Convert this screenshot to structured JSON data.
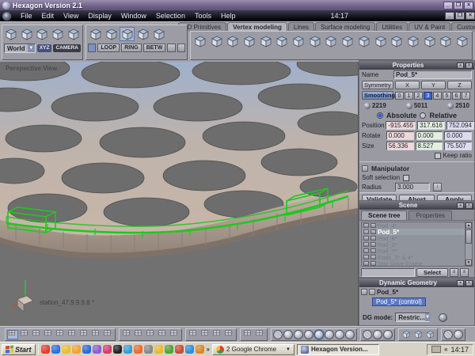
{
  "window": {
    "title": "Hexagon Version 2.1",
    "time": "14:17",
    "buttons": {
      "minimize": "_",
      "restore": "❐",
      "close": "×"
    }
  },
  "menu": {
    "items": [
      "File",
      "Edit",
      "View",
      "Display",
      "Window",
      "Selection",
      "Tools",
      "Help"
    ]
  },
  "tabs": {
    "items": [
      {
        "label": "3D Primitives",
        "active": false
      },
      {
        "label": "Vertex modeling",
        "active": true
      },
      {
        "label": "Lines",
        "active": false
      },
      {
        "label": "Surface modeling",
        "active": false
      },
      {
        "label": "Utilities",
        "active": false
      },
      {
        "label": "UV & Paint",
        "active": false
      },
      {
        "label": "Custom",
        "active": false
      }
    ]
  },
  "toolbar": {
    "world_dropdown": "World",
    "xyz_label": "XYZ",
    "camera_label": "CAMERA",
    "loop_label": "LOOP",
    "ring_label": "RING",
    "betw_label": "BETW"
  },
  "viewport": {
    "view_label": "Perspective View",
    "status_text": "station_47.9.9.9.8 *"
  },
  "properties_panel": {
    "title": "Properties",
    "name_label": "Name",
    "name_value": "Pod_5*",
    "symmetry_label": "Symmetry",
    "axis_buttons": [
      "X",
      "Y",
      "Z"
    ],
    "smoothing_label": "Smoothing",
    "smoothing_levels": [
      "0",
      "1",
      "2",
      "3",
      "4",
      "5",
      "6",
      "7"
    ],
    "smoothing_selected": "3",
    "counts": [
      "2219",
      "5011",
      "2510"
    ],
    "mode_absolute": "Absolute",
    "mode_relative": "Relative",
    "rows": [
      {
        "label": "Position",
        "x": "-915.455",
        "y": "317.616",
        "z": "752.094"
      },
      {
        "label": "Rotate",
        "x": "0.000",
        "y": "0.000",
        "z": "0.000"
      },
      {
        "label": "Size",
        "x": "56.336",
        "y": "8.527",
        "z": "75.507"
      }
    ],
    "keep_ratio_label": "Keep ratio",
    "manipulator_label": "Manipulator",
    "soft_selection_label": "Soft selection",
    "radius_label": "Radius",
    "radius_value": "3.000",
    "validate_label": "Validate",
    "abort_label": "Abort",
    "apply_label": "Apply"
  },
  "scene_panel": {
    "title": "Scene",
    "tabs": [
      {
        "label": "Scene tree",
        "active": true
      },
      {
        "label": "Properties",
        "active": false
      }
    ],
    "items": [
      {
        "label": "Pod_4*",
        "selected": false
      },
      {
        "label": "Pod_5*",
        "selected": true
      },
      {
        "label": "Pod_6*",
        "selected": false
      },
      {
        "label": "Pod_2*",
        "selected": false
      },
      {
        "label": "Pod_7*",
        "selected": false
      },
      {
        "label": "Pods_3* & 4*",
        "selected": false
      },
      {
        "label": "Star Drive Frame",
        "selected": false
      }
    ],
    "filter_value": "",
    "select_button": "Select"
  },
  "dynamic_geometry_panel": {
    "title": "Dynamic Geometry",
    "root_item": "Pod_5*",
    "child_item": "Pod_5* (control)",
    "dg_mode_label": "DG mode:",
    "dg_mode_value": "Restric..."
  },
  "taskbar": {
    "start_label": "Start",
    "chrome_button": "2 Google Chrome",
    "hexagon_button": "Hexagon Version...",
    "tray_time": "14:17"
  },
  "colors": {
    "selection_green": "#1ec81e",
    "accent_blue": "#3a62c8",
    "dome_tan": "#c0b0a4",
    "dome_sky": "#9fb0cc"
  }
}
